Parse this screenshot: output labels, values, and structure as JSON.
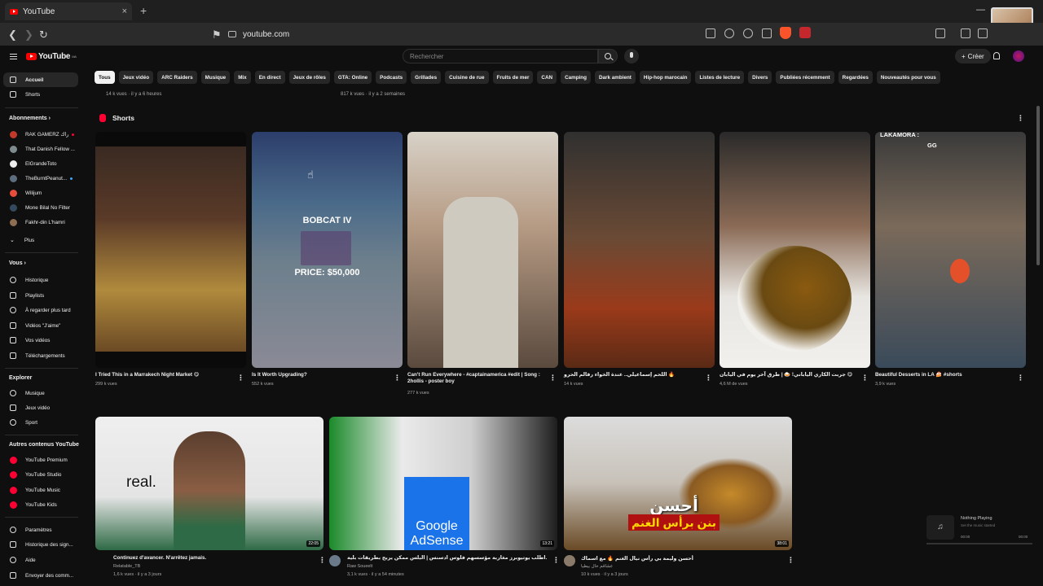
{
  "browser": {
    "tab_title": "YouTube",
    "tab_close": "×",
    "new_tab": "+",
    "url": "youtube.com"
  },
  "masthead": {
    "logo": "YouTube",
    "logo_region": "MA",
    "search_placeholder": "Rechercher",
    "create_label": "Créer",
    "create_plus": "+"
  },
  "chips": [
    "Tous",
    "Jeux vidéo",
    "ARC Raiders",
    "Musique",
    "Mix",
    "En direct",
    "Jeux de rôles",
    "GTA: Online",
    "Podcasts",
    "Grillades",
    "Cuisine de rue",
    "Fruits de mer",
    "CAN",
    "Camping",
    "Dark ambient",
    "Hip-hop marocain",
    "Listes de lecture",
    "Divers",
    "Publiées récemment",
    "Regardées",
    "Nouveautés pour vous"
  ],
  "sidebar": {
    "home": "Accueil",
    "shorts": "Shorts",
    "subscriptions_heading": "Abonnements",
    "subscriptions": [
      "RAK GAMERZ راك",
      "That Danish Fellow ...",
      "ElGrandeToto",
      "TheBurntPeanut...",
      "Wilijum",
      "Mone Bilal No Filter",
      "Fakhr-din L'hamri"
    ],
    "more": "Plus",
    "you_heading": "Vous",
    "you_items": [
      "Historique",
      "Playlists",
      "À regarder plus tard",
      "Vidéos \"J'aime\"",
      "Vos vidéos",
      "Téléchargements"
    ],
    "explore_heading": "Explorer",
    "explore_items": [
      "Musique",
      "Jeux vidéo",
      "Sport"
    ],
    "other_heading": "Autres contenus YouTube",
    "other_items": [
      "YouTube Premium",
      "YouTube Studio",
      "YouTube Music",
      "YouTube Kids"
    ],
    "bottom_items": [
      "Paramètres",
      "Historique des sign...",
      "Aide",
      "Envoyer des comm..."
    ]
  },
  "partial_row": {
    "meta_1": "14 k vues · il y a 6 heures",
    "meta_2": "817 k vues · il y a 2 semaines"
  },
  "shorts": {
    "heading": "Shorts",
    "items": [
      {
        "title": "I Tried This in a Marrakech Night Market 😋",
        "meta": "299 k vues"
      },
      {
        "title": "Is It Worth Upgrading?",
        "meta": "552 k vues",
        "overlay_1": "BOBCAT IV",
        "overlay_2": "PRICE: $50,000"
      },
      {
        "title": "Can't Run Everywhere - #captainamerica #edit | Song : 2hollis - poster boy",
        "meta": "277 k vues"
      },
      {
        "title": "اللحم إسماعيلي.. عندة الخواء رقالم الحرو 🔥",
        "meta": "14 k vues"
      },
      {
        "title": "جربت الكاري الياباني! 🍛 | طرق آخر يوم في اليابان 😋",
        "meta": "4,6 M de vues"
      },
      {
        "title": "Beautiful Desserts in LA 🍰 #shorts",
        "meta": "3,9 k vues",
        "overlay_1": "LAKAMORA :",
        "overlay_2": "GG"
      }
    ]
  },
  "videos": [
    {
      "title": "Continuez d'avancer. N'arrêtez jamais.",
      "channel": "Relatable_TB",
      "meta": "1,6 k vues · il y a 3 jours",
      "duration": "22:05",
      "overlay": "real."
    },
    {
      "title": "أنا وصلوني...أطلب يوتيوبرز مغاربة مؤسسهم فلوس أدسنس | البلس ممكن يربح بطريقات بلية",
      "channel": "Raw Soueelt",
      "meta": "3,1 k vues · il y a 54 minutes",
      "duration": "13:21",
      "overlay_1": "Google",
      "overlay_2": "AdSense"
    },
    {
      "title": "أحسن وليمة بي رأس نيال الغنم 🔥 مع اسماك",
      "channel": "عشاقم خال بيطيا",
      "meta": "10 k vues · il y a 3 jours",
      "duration": "38:01",
      "overlay_1": "أحسن",
      "overlay_2": "بنن برأس الغنم"
    }
  ],
  "mini_player": {
    "title": "Nothing Playing",
    "subtitle": "Set the music started",
    "time_left": "00:00",
    "time_right": "00:00"
  }
}
